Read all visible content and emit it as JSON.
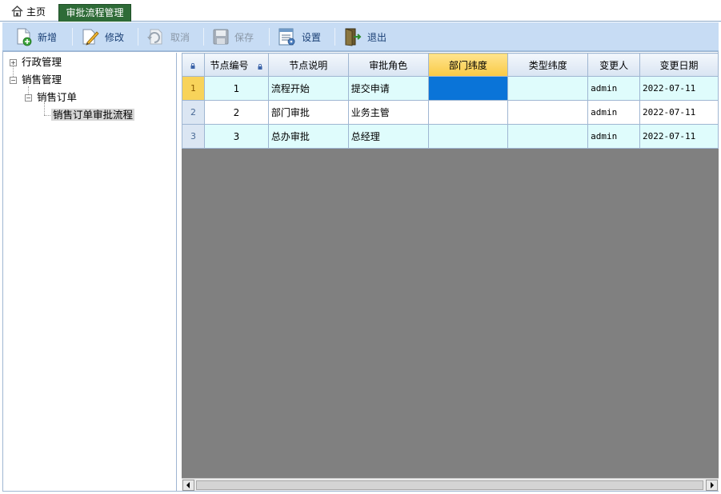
{
  "tabs": {
    "home_label": "主页",
    "active_label": "审批流程管理"
  },
  "toolbar": {
    "new_label": "新增",
    "edit_label": "修改",
    "cancel_label": "取消",
    "save_label": "保存",
    "settings_label": "设置",
    "exit_label": "退出"
  },
  "tree": {
    "admin_label": "行政管理",
    "sales_label": "销售管理",
    "sales_order_label": "销售订单",
    "sales_order_flow_label": "销售订单审批流程"
  },
  "grid": {
    "headers": [
      "节点编号",
      "节点说明",
      "审批角色",
      "部门纬度",
      "类型纬度",
      "变更人",
      "变更日期"
    ],
    "rows": [
      {
        "row_num": "1",
        "node_no": "1",
        "desc": "流程开始",
        "role": "提交申请",
        "dept": "",
        "type": "",
        "changer": "admin",
        "date": "2022-07-11"
      },
      {
        "row_num": "2",
        "node_no": "2",
        "desc": "部门审批",
        "role": "业务主管",
        "dept": "",
        "type": "",
        "changer": "admin",
        "date": "2022-07-11"
      },
      {
        "row_num": "3",
        "node_no": "3",
        "desc": "总办审批",
        "role": "总经理",
        "dept": "",
        "type": "",
        "changer": "admin",
        "date": "2022-07-11"
      }
    ]
  },
  "colors": {
    "tab_active": "#2e6b37",
    "toolbar_bg": "#c7dcf4",
    "row_bg": "#dffcfc",
    "selected_cell": "#0a74d8",
    "sorted_header": "#f9c945",
    "grid_empty": "#808080"
  }
}
